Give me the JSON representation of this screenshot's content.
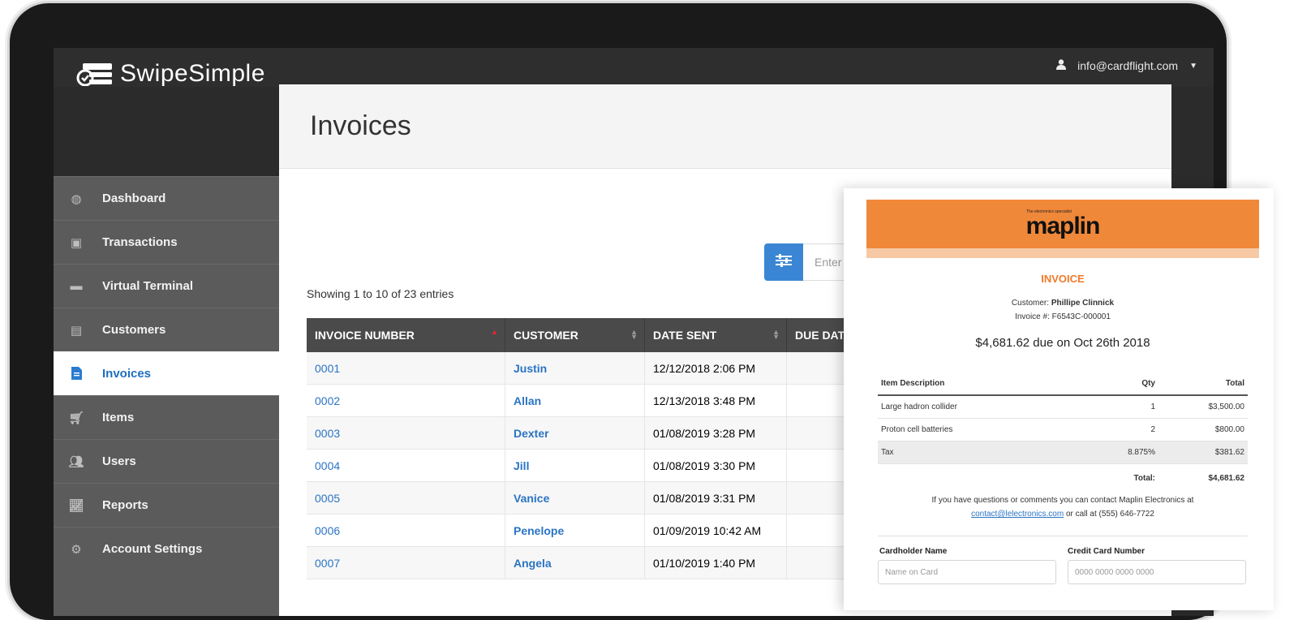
{
  "app": {
    "brand": "SwipeSimple"
  },
  "user": {
    "email": "info@cardflight.com"
  },
  "sidebar": {
    "items": [
      {
        "label": "Dashboard",
        "icon": "dashboard-icon"
      },
      {
        "label": "Transactions",
        "icon": "transactions-icon"
      },
      {
        "label": "Virtual Terminal",
        "icon": "card-icon"
      },
      {
        "label": "Customers",
        "icon": "id-card-icon"
      },
      {
        "label": "Invoices",
        "icon": "document-icon",
        "active": true
      },
      {
        "label": "Items",
        "icon": "cart-icon"
      },
      {
        "label": "Users",
        "icon": "users-icon"
      },
      {
        "label": "Reports",
        "icon": "chart-icon"
      },
      {
        "label": "Account Settings",
        "icon": "gear-icon"
      }
    ]
  },
  "main": {
    "title": "Invoices",
    "search_placeholder": "Enter a",
    "showing": "Showing 1 to 10 of 23 entries",
    "columns": [
      "INVOICE NUMBER",
      "CUSTOMER",
      "DATE SENT",
      "DUE DATE"
    ],
    "rows": [
      {
        "number": "0001",
        "customer": "Justin",
        "date": "12/12/2018 2:06 PM"
      },
      {
        "number": "0002",
        "customer": "Allan",
        "date": "12/13/2018 3:48 PM"
      },
      {
        "number": "0003",
        "customer": "Dexter",
        "date": "01/08/2019 3:28 PM"
      },
      {
        "number": "0004",
        "customer": "Jill",
        "date": "01/08/2019 3:30 PM"
      },
      {
        "number": "0005",
        "customer": "Vanice",
        "date": "01/08/2019 3:31 PM"
      },
      {
        "number": "0006",
        "customer": "Penelope",
        "date": "01/09/2019 10:42 AM"
      },
      {
        "number": "0007",
        "customer": "Angela",
        "date": "01/10/2019 1:40 PM"
      }
    ]
  },
  "invoice": {
    "brand": "maplin",
    "brand_tag": "The electronics specialist",
    "heading": "INVOICE",
    "customer_label": "Customer:",
    "customer_name": "Phillipe Clinnick",
    "invoice_no": "Invoice #: F6543C-000001",
    "due": "$4,681.62 due on Oct 26th 2018",
    "columns": [
      "Item Description",
      "Qty",
      "Total"
    ],
    "items": [
      {
        "desc": "Large hadron collider",
        "qty": "1",
        "total": "$3,500.00"
      },
      {
        "desc": "Proton cell batteries",
        "qty": "2",
        "total": "$800.00"
      }
    ],
    "tax": {
      "label": "Tax",
      "rate": "8.875%",
      "amount": "$381.62"
    },
    "total_label": "Total:",
    "total_value": "$4,681.62",
    "contact_text": "If you have questions or comments you can contact Maplin Electronics at",
    "contact_email": "contact@lelectronics.com",
    "contact_phone_text": "or call at (555) 646-7722",
    "cardholder_label": "Cardholder Name",
    "cardholder_placeholder": "Name on Card",
    "cc_label": "Credit Card Number",
    "cc_placeholder": "0000 0000 0000 0000"
  },
  "colors": {
    "accent": "#3a86d4",
    "invoice_orange": "#f0883a",
    "link": "#2a74c4"
  }
}
